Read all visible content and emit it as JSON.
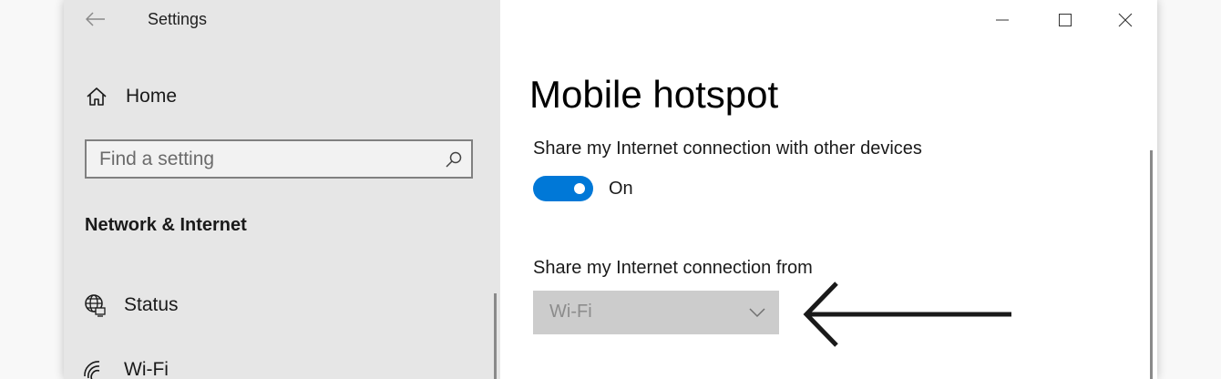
{
  "window": {
    "title": "Settings"
  },
  "sidebar": {
    "home_label": "Home",
    "search_placeholder": "Find a setting",
    "section_heading": "Network & Internet",
    "items": [
      {
        "label": "Status",
        "icon": "globe-monitor-icon"
      },
      {
        "label": "Wi-Fi",
        "icon": "wifi-icon"
      }
    ]
  },
  "main": {
    "page_title": "Mobile hotspot",
    "share_label": "Share my Internet connection with other devices",
    "toggle_state": "On",
    "toggle_on": true,
    "from_label": "Share my Internet connection from",
    "source_value": "Wi-Fi"
  },
  "colors": {
    "accent": "#0078d7",
    "sidebar_bg": "#e6e6e6",
    "dropdown_disabled_bg": "#cccccc"
  },
  "icons": {
    "back": "back-arrow-icon",
    "home": "home-icon",
    "search": "search-icon",
    "minimize": "minimize-icon",
    "maximize": "maximize-icon",
    "close": "close-icon",
    "dropdown": "chevron-down-icon",
    "annotation": "pointer-arrow-icon"
  }
}
